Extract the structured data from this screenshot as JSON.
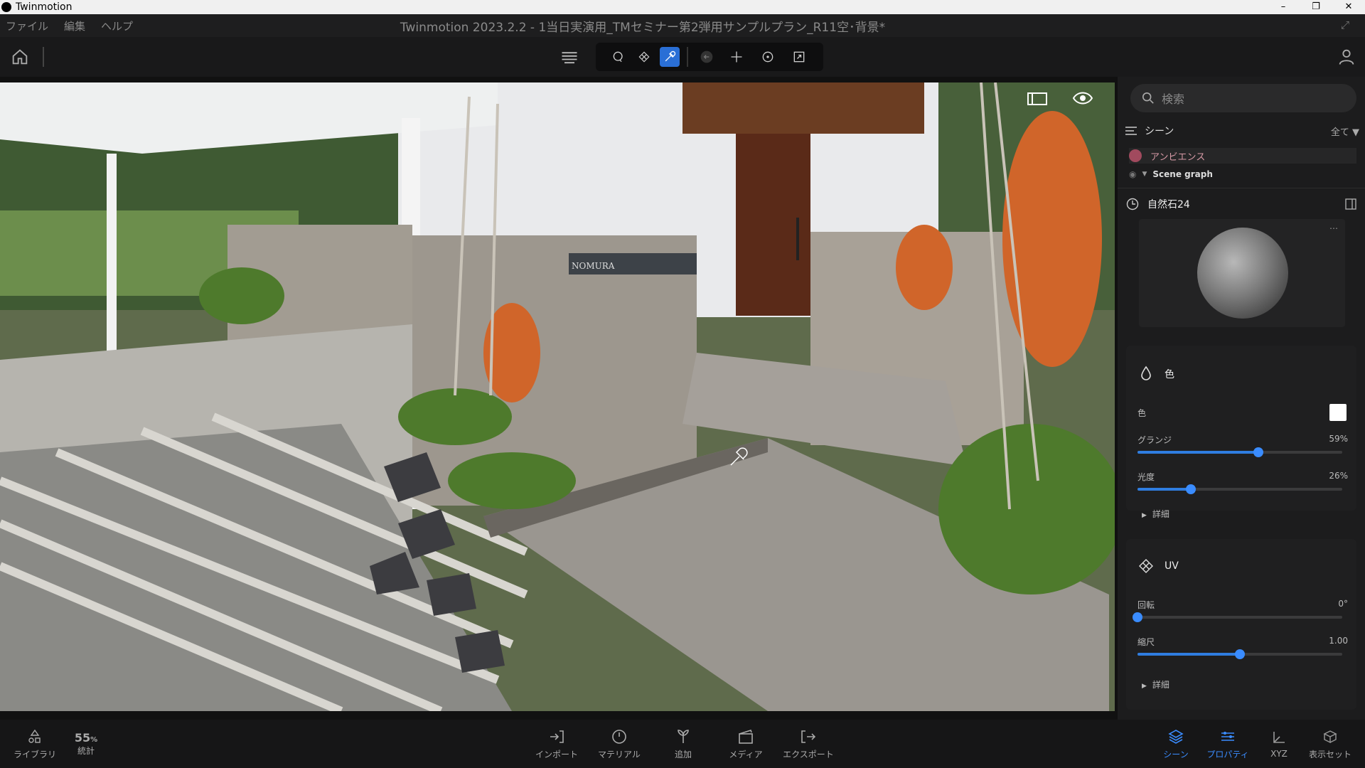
{
  "os": {
    "app_name": "Twinmotion",
    "minimize": "–",
    "restore": "❐",
    "close": "✕"
  },
  "menu": {
    "items": [
      "ファイル",
      "編集",
      "ヘルプ"
    ],
    "document_title": "Twinmotion 2023.2.2 - 1当日実演用_TMセミナー第2弾用サンプルプラン_R11空･背景*"
  },
  "toolbar": {
    "icons": [
      "home-icon",
      "layers-icon",
      "lasso-icon",
      "uv-icon",
      "eyedropper-icon",
      "back-icon",
      "move-icon",
      "rotate-icon",
      "scale-icon",
      "user-icon"
    ],
    "active_tool": "eyedropper"
  },
  "viewport": {
    "nameplate": "NOMURA"
  },
  "panel": {
    "search_placeholder": "検索",
    "scene_label": "シーン",
    "filter_label": "全て",
    "ambience_label": "アンビエンス",
    "scene_graph_label": "Scene graph",
    "selected_material": "自然石24",
    "color_section": {
      "title": "色",
      "color_label": "色",
      "color_value": "#ffffff",
      "grunge_label": "グランジ",
      "grunge_value": "59%",
      "grunge_fraction": 0.59,
      "gloss_label": "光度",
      "gloss_value": "26%",
      "gloss_fraction": 0.26,
      "detail_label": "詳細"
    },
    "uv_section": {
      "title": "UV",
      "rotation_label": "回転",
      "rotation_value": "0°",
      "rotation_fraction": 0,
      "scale_label": "縮尺",
      "scale_value": "1.00",
      "scale_fraction": 0.5,
      "detail_label": "詳細"
    }
  },
  "bottombar": {
    "library_label": "ライブラリ",
    "stats_value": "55",
    "stats_unit": "%",
    "stats_label": "統計",
    "import_label": "インポート",
    "material_label": "マテリアル",
    "add_label": "追加",
    "media_label": "メディア",
    "export_label": "エクスポート",
    "scene_label": "シーン",
    "properties_label": "プロパティ",
    "xyz_label": "XYZ",
    "display_set_label": "表示セット"
  },
  "colors": {
    "accent": "#2f7de0",
    "ambience": "#a14a5e"
  }
}
